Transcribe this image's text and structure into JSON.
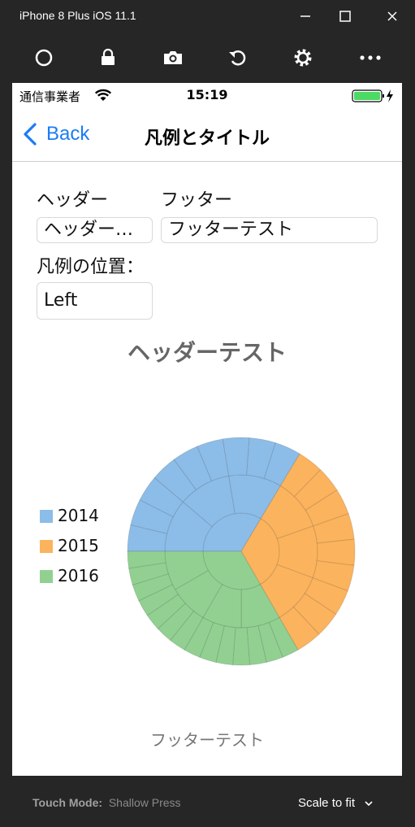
{
  "window": {
    "title": "iPhone 8 Plus iOS 11.1"
  },
  "status_bar": {
    "carrier": "通信事業者",
    "time": "15:19"
  },
  "nav": {
    "back_label": "Back",
    "title": "凡例とタイトル"
  },
  "form": {
    "header_label": "ヘッダー",
    "header_value": "ヘッダー…",
    "footer_label": "フッター",
    "footer_value": "フッターテスト",
    "legend_pos_label": "凡例の位置：",
    "legend_pos_value": "Left"
  },
  "chart_data": {
    "type": "pie",
    "subtype": "sunburst",
    "title": "ヘッダーテスト",
    "footer": "フッターテスト",
    "legend_position": "left",
    "series": [
      {
        "name": "2014",
        "color": "#8cbde8",
        "angle_start": 0,
        "angle_end": 121,
        "quarters": 3,
        "months": 9
      },
      {
        "name": "2015",
        "color": "#fcb35d",
        "angle_start": 121,
        "angle_end": 240,
        "quarters": 3,
        "months": 9
      },
      {
        "name": "2016",
        "color": "#92d092",
        "angle_start": 240,
        "angle_end": 360,
        "quarters": 4,
        "months": 14
      }
    ]
  },
  "bottom": {
    "touch_mode_label": "Touch Mode:",
    "touch_mode_value": "Shallow Press",
    "scale_label": "Scale to fit"
  }
}
